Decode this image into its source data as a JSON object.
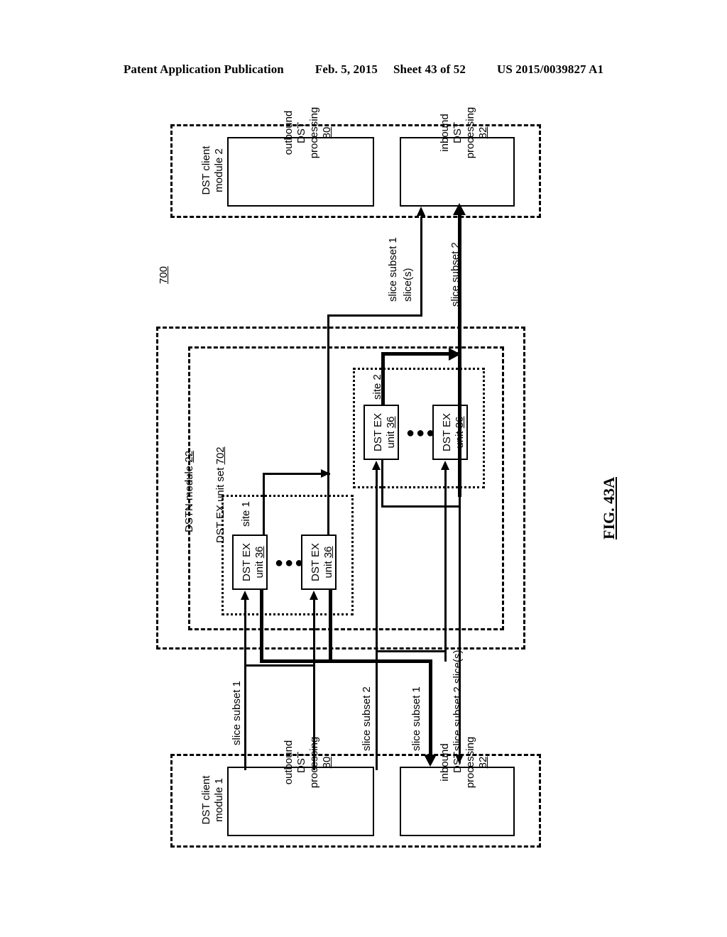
{
  "header": {
    "publication": "Patent Application Publication",
    "date": "Feb. 5, 2015",
    "sheet": "Sheet 43 of 52",
    "number": "US 2015/0039827 A1"
  },
  "figure": {
    "label": "FIG. 43A",
    "system_ref": "700"
  },
  "client_module_top": {
    "title": "DST client\nmodule 2",
    "title_line1": "DST client",
    "title_line2": "module 2",
    "outbound": {
      "line1": "outbound",
      "line2": "DST",
      "line3": "processing",
      "ref": "80"
    },
    "inbound": {
      "line1": "inbound",
      "line2": "DST",
      "line3": "processing",
      "ref": "82"
    }
  },
  "client_module_bottom": {
    "title_line1": "DST client",
    "title_line2": "module 1",
    "outbound": {
      "line1": "outbound",
      "line2": "DST",
      "line3": "processing",
      "ref": "80"
    },
    "inbound": {
      "line1": "inbound",
      "line2": "DST",
      "line3": "processing",
      "ref": "82"
    }
  },
  "dstn_module": {
    "title": "DSTN module",
    "ref": "22"
  },
  "unit_set": {
    "title": "DST EX unit set",
    "ref": "702"
  },
  "sites": [
    {
      "name": "site 1",
      "units": [
        {
          "line1": "DST EX",
          "line2": "unit",
          "ref": "36"
        },
        {
          "line1": "DST EX",
          "line2": "unit",
          "ref": "36"
        }
      ],
      "ellipsis": "●●●"
    },
    {
      "name": "site 2",
      "units": [
        {
          "line1": "DST EX",
          "line2": "unit",
          "ref": "36"
        },
        {
          "line1": "DST EX",
          "line2": "unit",
          "ref": "36"
        }
      ],
      "ellipsis": "●●●"
    }
  ],
  "connection_labels": {
    "top_a_line1": "slice subset 1",
    "top_a_line2": "slice(s)",
    "top_b": "slice subset 2",
    "bottom_a": "slice subset 1",
    "bottom_b": "slice subset 2",
    "bottom_c": "slice subset 1",
    "bottom_d": "slice subset 2 slice(s)"
  }
}
